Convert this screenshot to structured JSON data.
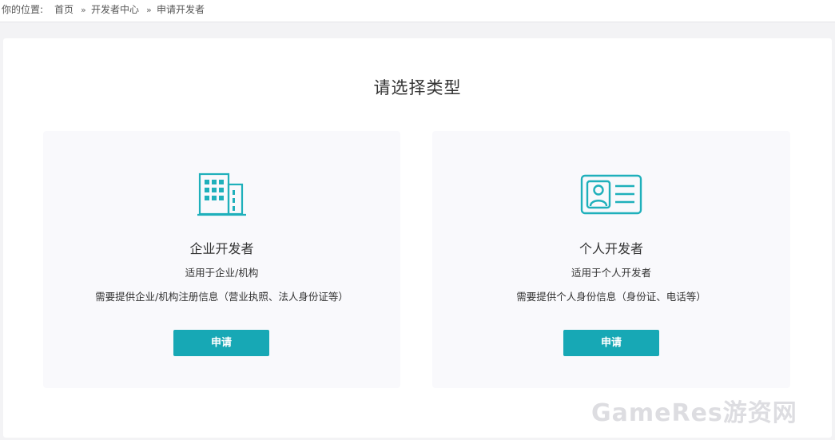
{
  "breadcrumb": {
    "prefix": "你的位置:",
    "items": [
      "首页",
      "开发者中心"
    ],
    "separator": "»",
    "current": "申请开发者"
  },
  "page": {
    "title": "请选择类型"
  },
  "panels": [
    {
      "icon": "building-icon",
      "title": "企业开发者",
      "subtitle": "适用于企业/机构",
      "description": "需要提供企业/机构注册信息（营业执照、法人身份证等）",
      "button_label": "申请"
    },
    {
      "icon": "id-card-icon",
      "title": "个人开发者",
      "subtitle": "适用于个人开发者",
      "description": "需要提供个人身份信息（身份证、电话等）",
      "button_label": "申请"
    }
  ],
  "watermark": {
    "text": "GameRes游资网"
  },
  "colors": {
    "accent": "#17a8b5",
    "icon": "#1fb0bb",
    "panel_bg": "#f9f9fc",
    "page_bg": "#f3f3f5"
  }
}
